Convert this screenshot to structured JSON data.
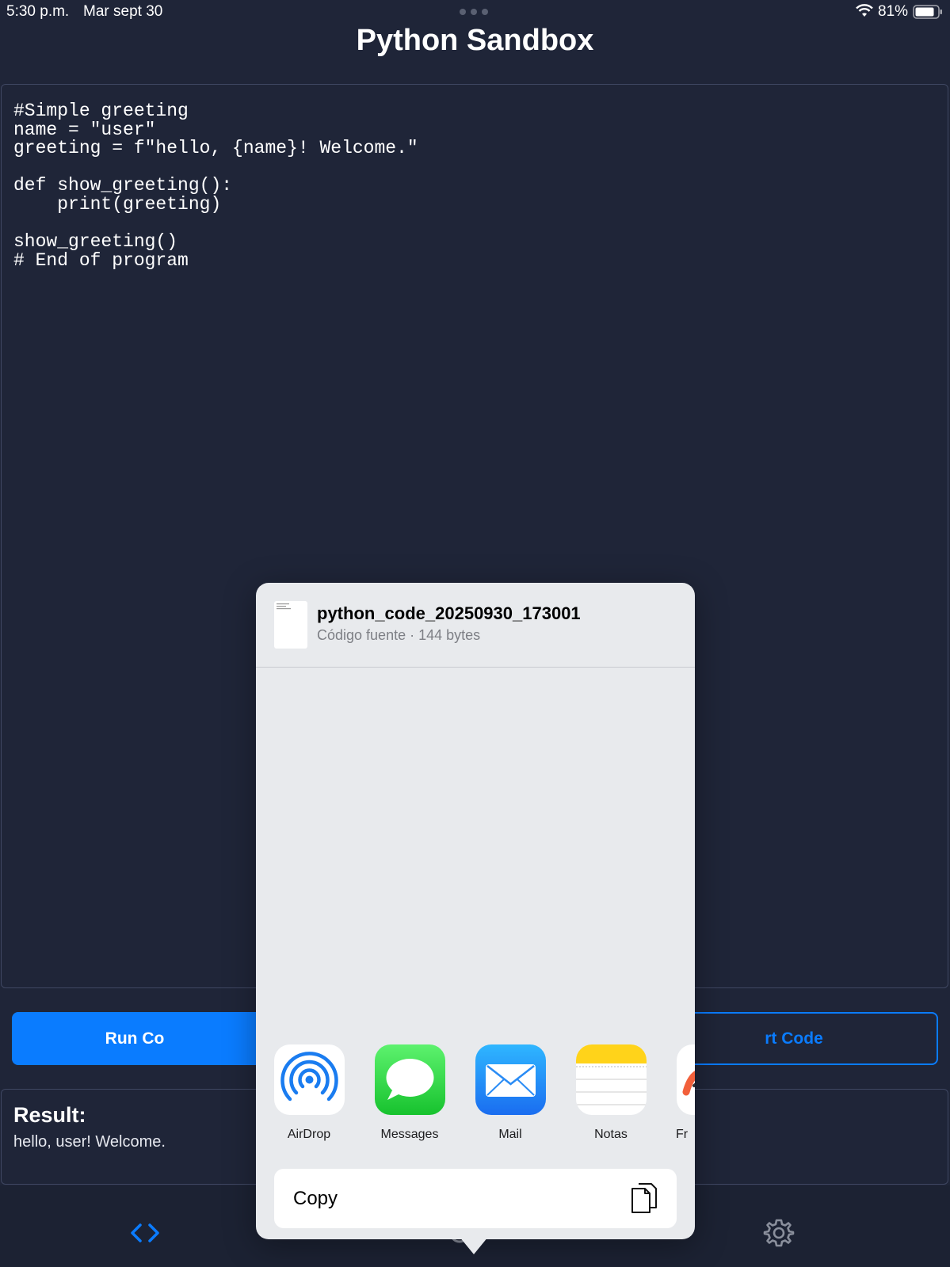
{
  "status_bar": {
    "time": "5:30 p.m.",
    "date": "Mar sept 30",
    "battery": "81%"
  },
  "app": {
    "title": "Python Sandbox"
  },
  "editor": {
    "code": "#Simple greeting\nname = \"user\"\ngreeting = f\"hello, {name}! Welcome.\"\n\ndef show_greeting():\n    print(greeting)\n\nshow_greeting()\n# End of program"
  },
  "actions": {
    "run_label": "Run Co",
    "export_label": "rt Code"
  },
  "result": {
    "title": "Result:",
    "output": "hello, user! Welcome."
  },
  "share_sheet": {
    "file_name": "python_code_20250930_173001",
    "file_meta": "Código fuente · 144 bytes",
    "apps": [
      {
        "label": "AirDrop",
        "icon": "airdrop-icon"
      },
      {
        "label": "Messages",
        "icon": "messages-icon"
      },
      {
        "label": "Mail",
        "icon": "mail-icon"
      },
      {
        "label": "Notas",
        "icon": "notes-icon"
      },
      {
        "label": "Fr",
        "icon": "freeform-icon"
      }
    ],
    "copy_label": "Copy"
  },
  "tab_bar": {
    "items": [
      {
        "icon": "code-icon"
      },
      {
        "icon": "export-icon"
      },
      {
        "icon": "gear-icon"
      }
    ]
  },
  "colors": {
    "background": "#1f2538",
    "accent": "#0a7cff",
    "sheet": "#e8eaed"
  }
}
